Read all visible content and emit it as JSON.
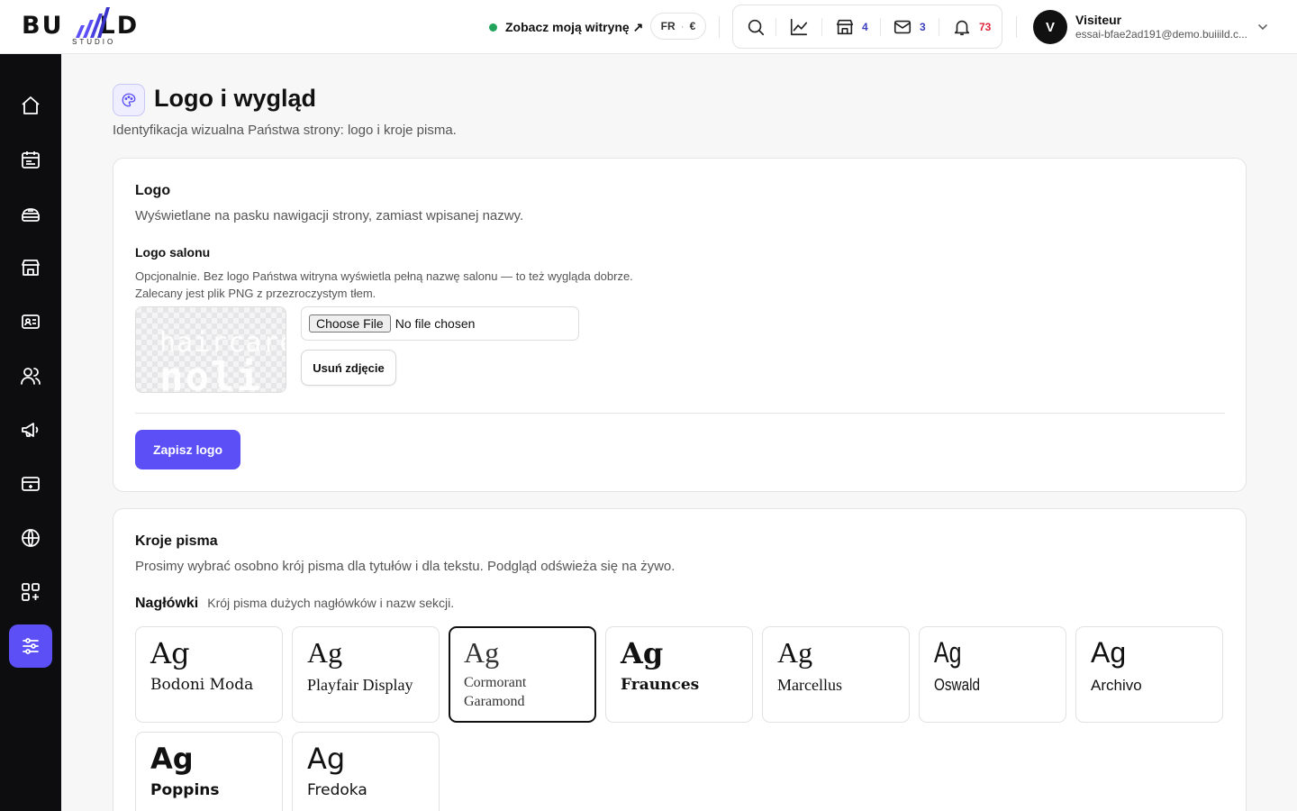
{
  "brand": {
    "name_left": "BU",
    "name_right": "LD",
    "sub": "STUDIO"
  },
  "header": {
    "site_link": "Zobacz moją witrynę ↗",
    "lang": "FR",
    "lang_sep": "·",
    "currency": "€",
    "counts": {
      "shop": "4",
      "mail": "3",
      "bell": "73"
    },
    "user_name": "Visiteur",
    "user_email": "essai-bfae2ad191@demo.buiiild.c..."
  },
  "sidebar": {
    "items": [
      "home-icon",
      "calendar-icon",
      "services-icon",
      "shop-icon",
      "contact-card-icon",
      "users-icon",
      "megaphone-icon",
      "payment-card-icon",
      "globe-icon",
      "apps-icon",
      "settings-sliders-icon"
    ],
    "active_index": 10
  },
  "page": {
    "title": "Logo i wygląd",
    "subtitle": "Identyfikacja wizualna Państwa strony: logo i kroje pisma."
  },
  "logo_section": {
    "title": "Logo",
    "description": "Wyświetlane na pasku nawigacji strony, zamiast wpisanej nazwy.",
    "field_label": "Logo salonu",
    "help_line1": "Opcjonalnie. Bez logo Państwa witryna wyświetla pełną nazwę salonu — to też wygląda dobrze.",
    "help_line2": "Zalecany jest plik PNG z przezroczystym tłem.",
    "preview_text1": "haircare",
    "preview_text2": "noli",
    "choose_file": "Choose File",
    "no_file": "No file chosen",
    "remove_button": "Usuń zdjęcie",
    "save_button": "Zapisz logo"
  },
  "fonts_section": {
    "title": "Kroje pisma",
    "description": "Prosimy wybrać osobno krój pisma dla tytułów i dla tekstu. Podgląd odświeża się na żywo.",
    "headings_label": "Nagłówki",
    "headings_desc": "Krój pisma dużych nagłówków i nazw sekcji.",
    "sample": "Ag",
    "fonts": [
      {
        "name": "Bodoni Moda"
      },
      {
        "name": "Playfair Display"
      },
      {
        "name": "Cormorant Garamond"
      },
      {
        "name": "Fraunces"
      },
      {
        "name": "Marcellus"
      },
      {
        "name": "Oswald"
      },
      {
        "name": "Archivo"
      },
      {
        "name": "Poppins"
      },
      {
        "name": "Fredoka"
      }
    ],
    "selected": "Cormorant Garamond"
  },
  "colors": {
    "accent": "#5b4ff5",
    "mail_count": "#3b3fbf",
    "bell_count": "#e0263a",
    "online_dot": "#22a55a",
    "sidebar_bg": "#0d0d10"
  }
}
